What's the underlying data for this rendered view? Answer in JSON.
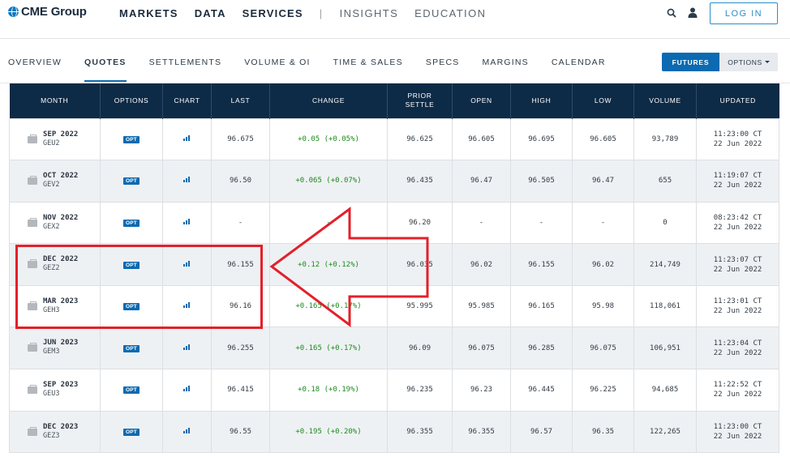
{
  "brand": {
    "name": "CME Group"
  },
  "nav": {
    "items": [
      {
        "label": "MARKETS",
        "style": "bold"
      },
      {
        "label": "DATA",
        "style": "bold"
      },
      {
        "label": "SERVICES",
        "style": "bold"
      },
      {
        "label": "|",
        "style": "sep"
      },
      {
        "label": "INSIGHTS",
        "style": "light"
      },
      {
        "label": "EDUCATION",
        "style": "light"
      }
    ],
    "login_label": "LOG IN"
  },
  "subnav": {
    "tabs": [
      {
        "label": "OVERVIEW",
        "active": false
      },
      {
        "label": "QUOTES",
        "active": true
      },
      {
        "label": "SETTLEMENTS",
        "active": false
      },
      {
        "label": "VOLUME & OI",
        "active": false
      },
      {
        "label": "TIME & SALES",
        "active": false
      },
      {
        "label": "SPECS",
        "active": false
      },
      {
        "label": "MARGINS",
        "active": false
      },
      {
        "label": "CALENDAR",
        "active": false
      }
    ],
    "futures_label": "FUTURES",
    "options_label": "OPTIONS"
  },
  "table": {
    "headers": [
      [
        "MONTH"
      ],
      [
        "OPTIONS"
      ],
      [
        "CHART"
      ],
      [
        "LAST"
      ],
      [
        "CHANGE"
      ],
      [
        "PRIOR",
        "SETTLE"
      ],
      [
        "OPEN"
      ],
      [
        "HIGH"
      ],
      [
        "LOW"
      ],
      [
        "VOLUME"
      ],
      [
        "UPDATED"
      ]
    ],
    "opt_label": "OPT",
    "rows": [
      {
        "month": "SEP 2022",
        "code": "GEU2",
        "last": "96.675",
        "change": "+0.05 (+0.05%)",
        "prior": "96.625",
        "open": "96.605",
        "high": "96.695",
        "low": "96.605",
        "volume": "93,789",
        "time": "11:23:00 CT",
        "date": "22 Jun 2022"
      },
      {
        "month": "OCT 2022",
        "code": "GEV2",
        "last": "96.50",
        "change": "+0.065 (+0.07%)",
        "prior": "96.435",
        "open": "96.47",
        "high": "96.505",
        "low": "96.47",
        "volume": "655",
        "time": "11:19:07 CT",
        "date": "22 Jun 2022"
      },
      {
        "month": "NOV 2022",
        "code": "GEX2",
        "last": "-",
        "change": "-",
        "prior": "96.20",
        "open": "-",
        "high": "-",
        "low": "-",
        "volume": "0",
        "time": "08:23:42 CT",
        "date": "22 Jun 2022"
      },
      {
        "month": "DEC 2022",
        "code": "GEZ2",
        "last": "96.155",
        "change": "+0.12 (+0.12%)",
        "prior": "96.035",
        "open": "96.02",
        "high": "96.155",
        "low": "96.02",
        "volume": "214,749",
        "time": "11:23:07 CT",
        "date": "22 Jun 2022"
      },
      {
        "month": "MAR 2023",
        "code": "GEH3",
        "last": "96.16",
        "change": "+0.165 (+0.17%)",
        "prior": "95.995",
        "open": "95.985",
        "high": "96.165",
        "low": "95.98",
        "volume": "118,061",
        "time": "11:23:01 CT",
        "date": "22 Jun 2022"
      },
      {
        "month": "JUN 2023",
        "code": "GEM3",
        "last": "96.255",
        "change": "+0.165 (+0.17%)",
        "prior": "96.09",
        "open": "96.075",
        "high": "96.285",
        "low": "96.075",
        "volume": "106,951",
        "time": "11:23:04 CT",
        "date": "22 Jun 2022"
      },
      {
        "month": "SEP 2023",
        "code": "GEU3",
        "last": "96.415",
        "change": "+0.18 (+0.19%)",
        "prior": "96.235",
        "open": "96.23",
        "high": "96.445",
        "low": "96.225",
        "volume": "94,685",
        "time": "11:22:52 CT",
        "date": "22 Jun 2022"
      },
      {
        "month": "DEC 2023",
        "code": "GEZ3",
        "last": "96.55",
        "change": "+0.195 (+0.20%)",
        "prior": "96.355",
        "open": "96.355",
        "high": "96.57",
        "low": "96.35",
        "volume": "122,265",
        "time": "11:23:00 CT",
        "date": "22 Jun 2022"
      }
    ]
  },
  "colors": {
    "accent": "#0b6ab1",
    "header_bg": "#0d2a46",
    "positive": "#1e8a1e",
    "annotation": "#e3202a"
  },
  "icons": [
    "search-icon",
    "user-icon",
    "briefcase-icon",
    "bar-chart-icon"
  ]
}
